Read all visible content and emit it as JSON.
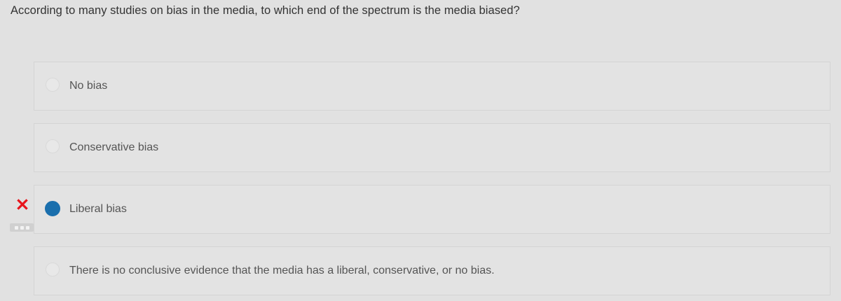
{
  "question": {
    "text": "According to many studies on bias in the media, to which end of the spectrum is the media biased?"
  },
  "options": [
    {
      "label": "No bias",
      "selected": false
    },
    {
      "label": "Conservative bias",
      "selected": false
    },
    {
      "label": "Liberal bias",
      "selected": true
    },
    {
      "label": "There is no conclusive evidence that the media has a liberal, conservative, or no bias.",
      "selected": false
    }
  ],
  "feedback": {
    "incorrect_icon": "x-icon",
    "incorrect_color": "#e8141b",
    "more_icon": "more-options-icon"
  },
  "colors": {
    "background": "#e1e1e1",
    "selected_radio": "#1a6fad",
    "text": "#555555"
  }
}
